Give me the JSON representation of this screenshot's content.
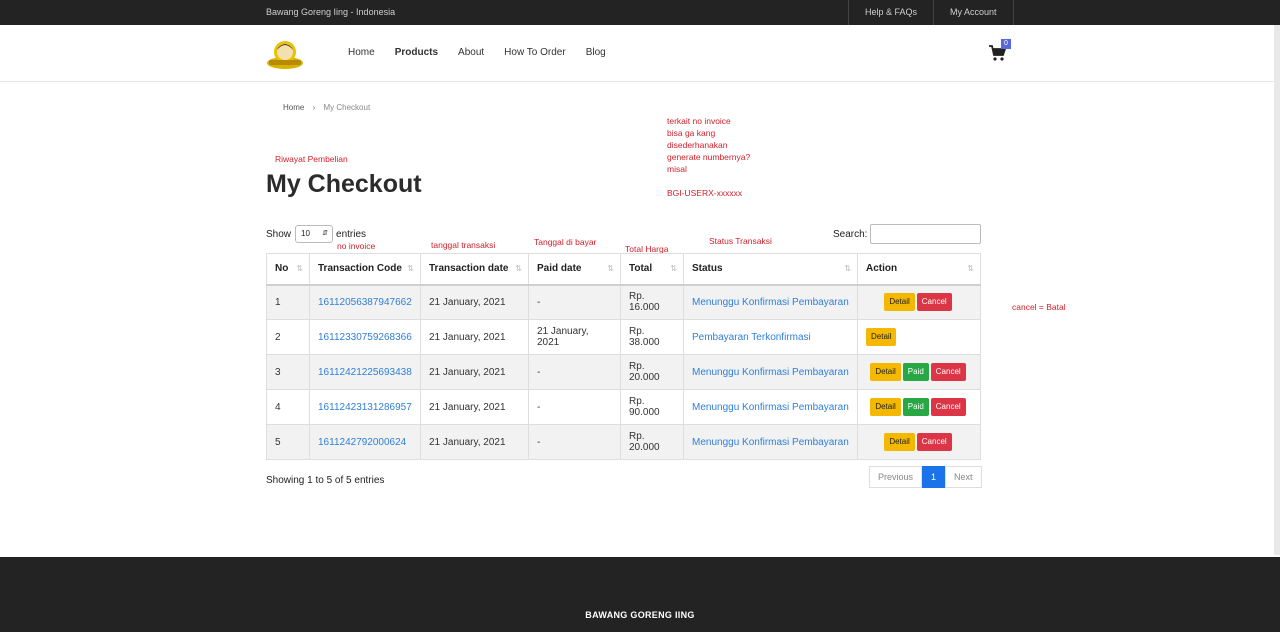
{
  "topbar": {
    "site_label": "Bawang Goreng Iing - Indonesia",
    "links": [
      "Help & FAQs",
      "My Account"
    ]
  },
  "nav": {
    "items": [
      "Home",
      "Products",
      "About",
      "How To Order",
      "Blog"
    ],
    "active": "Products",
    "cart_count": "0"
  },
  "breadcrumb": {
    "home": "Home",
    "sep": "›",
    "current": "My Checkout"
  },
  "annotations": {
    "riwayat": "Riwayat Pembelian",
    "invoice_note": [
      "terkait no invoice",
      "bisa ga kang",
      "disederhanakan",
      "generate numbernya?",
      "misal",
      "",
      "BGI-USERX-xxxxxx"
    ],
    "no_invoice": "no invoice",
    "tanggal_transaksi": "tanggal transaksi",
    "tanggal_bayar": "Tanggal di bayar",
    "total_harga": "Total Harga",
    "status_transaksi": "Status Transaksi",
    "cancel_batal": "cancel = Batal"
  },
  "page": {
    "title": "My Checkout",
    "show_label": "Show",
    "entries_value": "10",
    "entries_label": "entries",
    "search_label": "Search:",
    "search_value": ""
  },
  "table": {
    "headers": [
      "No",
      "Transaction Code",
      "Transaction date",
      "Paid date",
      "Total",
      "Status",
      "Action"
    ],
    "rows": [
      {
        "no": "1",
        "code": "16112056387947662",
        "tdate": "21 January, 2021",
        "pdate": "-",
        "total": "Rp. 16.000",
        "status": "Menunggu Konfirmasi Pembayaran",
        "actions": [
          "Detail",
          "Cancel"
        ]
      },
      {
        "no": "2",
        "code": "16112330759268366",
        "tdate": "21 January, 2021",
        "pdate": "21 January, 2021",
        "total": "Rp. 38.000",
        "status": "Pembayaran Terkonfirmasi",
        "actions": [
          "Detail"
        ]
      },
      {
        "no": "3",
        "code": "16112421225693438",
        "tdate": "21 January, 2021",
        "pdate": "-",
        "total": "Rp. 20.000",
        "status": "Menunggu Konfirmasi Pembayaran",
        "actions": [
          "Detail",
          "Paid",
          "Cancel"
        ]
      },
      {
        "no": "4",
        "code": "16112423131286957",
        "tdate": "21 January, 2021",
        "pdate": "-",
        "total": "Rp. 90.000",
        "status": "Menunggu Konfirmasi Pembayaran",
        "actions": [
          "Detail",
          "Paid",
          "Cancel"
        ]
      },
      {
        "no": "5",
        "code": "1611242792000624",
        "tdate": "21 January, 2021",
        "pdate": "-",
        "total": "Rp. 20.000",
        "status": "Menunggu Konfirmasi Pembayaran",
        "actions": [
          "Detail",
          "Cancel"
        ]
      }
    ]
  },
  "footer_info": "Showing 1 to 5 of 5 entries",
  "pagination": {
    "previous": "Previous",
    "current": "1",
    "next": "Next"
  },
  "footer": {
    "brand": "BAWANG GORENG IING"
  },
  "colors": {
    "topbar": "#232323",
    "link": "#2f7fd8",
    "detail": "#f5b800",
    "paid": "#28a745",
    "cancel": "#dc3545",
    "annotation": "#d0202a",
    "page_active": "#1a73e8"
  }
}
